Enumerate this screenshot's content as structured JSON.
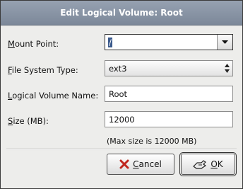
{
  "dialog": {
    "title": "Edit Logical Volume: Root"
  },
  "fields": {
    "mount_point": {
      "label_mnemonic": "M",
      "label_rest": "ount Point:",
      "value": "/"
    },
    "fs_type": {
      "label_mnemonic": "F",
      "label_rest": "ile System Type:",
      "value": "ext3"
    },
    "lv_name": {
      "label_mnemonic": "L",
      "label_rest": "ogical Volume Name:",
      "value": "Root"
    },
    "size": {
      "label_mnemonic": "S",
      "label_rest": "ize (MB):",
      "value": "12000"
    }
  },
  "hint": "(Max size is 12000 MB)",
  "buttons": {
    "cancel": {
      "mnemonic": "C",
      "rest": "ancel",
      "icon": "cancel-x-icon",
      "icon_color": "#c0261e"
    },
    "ok": {
      "mnemonic": "O",
      "rest": "K",
      "icon": "ok-hand-icon"
    }
  }
}
